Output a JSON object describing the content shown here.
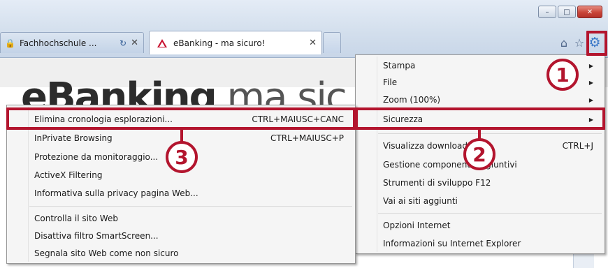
{
  "window": {
    "minimize": "–",
    "maximize": "□",
    "close": "✕"
  },
  "tabs": [
    {
      "title": "Fachhochschule ...",
      "icon": "lock-icon",
      "refresh": "↻",
      "close": "✕"
    },
    {
      "title": "eBanking - ma sicuro!",
      "icon": "ebanking-logo-icon",
      "close": "✕"
    }
  ],
  "toolbar": {
    "home": "⌂",
    "favorites": "☆",
    "tools": "⚙"
  },
  "page": {
    "logo_bold": "eBanking",
    "logo_thin": " ma sic"
  },
  "tools_menu": {
    "items": [
      {
        "label": "Stampa",
        "submenu": true
      },
      {
        "label": "File",
        "submenu": true
      },
      {
        "label": "Zoom (100%)",
        "submenu": true
      },
      {
        "label": "Sicurezza",
        "submenu": true
      },
      {
        "label": "Visualizza downloads",
        "shortcut": "CTRL+J"
      },
      {
        "label": "Gestione componenti aggiuntivi"
      },
      {
        "label": "Strumenti di sviluppo F12"
      },
      {
        "label": "Vai ai siti aggiunti"
      },
      {
        "label": "Opzioni Internet"
      },
      {
        "label": "Informazioni su Internet Explorer"
      }
    ]
  },
  "security_menu": {
    "items": [
      {
        "label": "Elimina cronologia esplorazioni...",
        "shortcut": "CTRL+MAIUSC+CANC"
      },
      {
        "label": "InPrivate Browsing",
        "shortcut": "CTRL+MAIUSC+P"
      },
      {
        "label": "Protezione da monitoraggio..."
      },
      {
        "label": "ActiveX Filtering"
      },
      {
        "label": "Informativa sulla privacy pagina Web..."
      },
      {
        "label": "Controlla il sito Web"
      },
      {
        "label": "Disattiva filtro SmartScreen..."
      },
      {
        "label": "Segnala sito Web come non sicuro"
      }
    ]
  },
  "callouts": {
    "one": "1",
    "two": "2",
    "three": "3"
  },
  "colors": {
    "highlight": "#b3152e",
    "accent": "#3b78c8"
  }
}
